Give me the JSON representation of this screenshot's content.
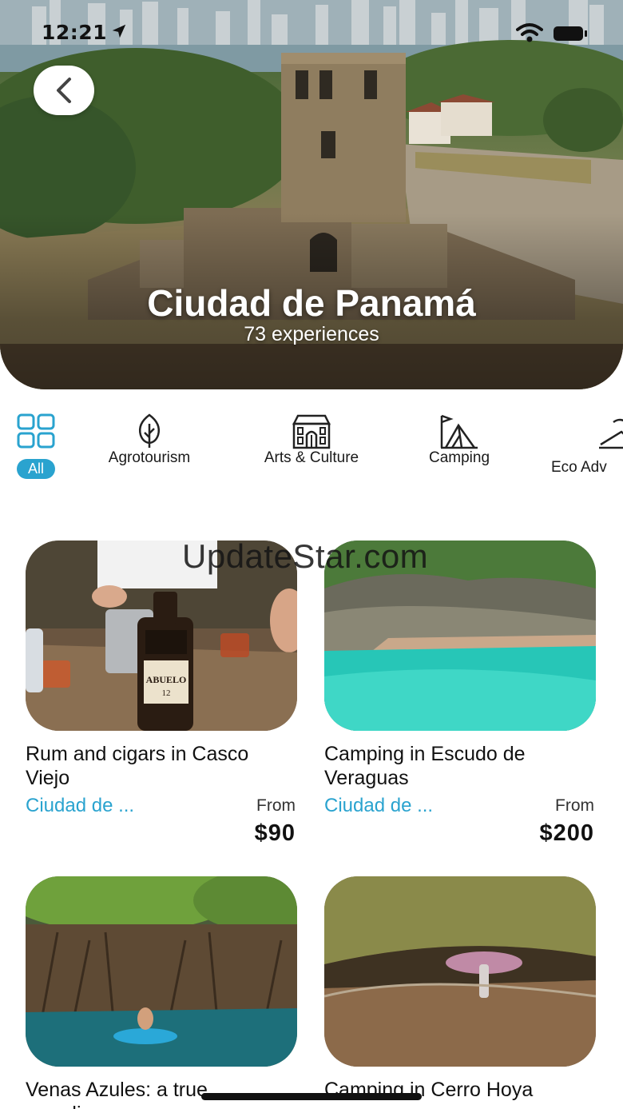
{
  "status": {
    "time": "12:21"
  },
  "hero": {
    "title": "Ciudad de Panamá",
    "subtitle": "73 experiences"
  },
  "categories": [
    {
      "label": "All",
      "icon": "grid-icon",
      "active": true
    },
    {
      "label": "Agrotourism",
      "icon": "leaf-icon",
      "active": false
    },
    {
      "label": "Arts & Culture",
      "icon": "building-icon",
      "active": false
    },
    {
      "label": "Camping",
      "icon": "tent-icon",
      "active": false
    },
    {
      "label": "Eco Adv",
      "icon": "mountain-icon",
      "active": false
    }
  ],
  "watermark": "UpdateStar.com",
  "experiences": [
    {
      "title": "Rum and cigars in Casco Viejo",
      "location": "Ciudad de ...",
      "from": "From",
      "price": "$90"
    },
    {
      "title": "Camping in Escudo de Veraguas",
      "location": "Ciudad de ...",
      "from": "From",
      "price": "$200"
    },
    {
      "title": "Venas Azules: a true paradise",
      "location": "",
      "from": "",
      "price": ""
    },
    {
      "title": "Camping in Cerro Hoya",
      "location": "",
      "from": "",
      "price": ""
    }
  ],
  "colors": {
    "accent": "#2aa3cf",
    "text": "#111111",
    "background": "#ffffff"
  }
}
